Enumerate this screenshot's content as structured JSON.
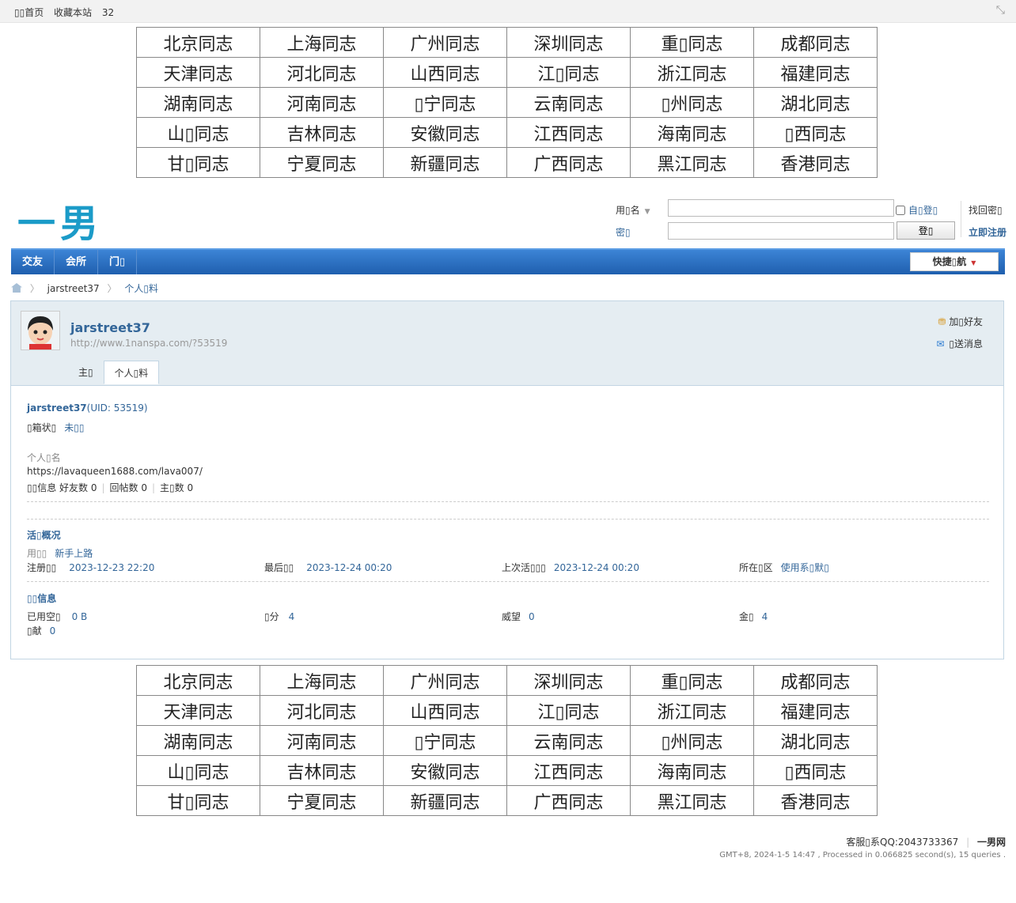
{
  "topbar": {
    "home_label": "▯▯首页",
    "favorite_label": "收藏本站",
    "count": "32"
  },
  "cities": [
    [
      "北京同志",
      "上海同志",
      "广州同志",
      "深圳同志",
      "重▯同志",
      "成都同志"
    ],
    [
      "天津同志",
      "河北同志",
      "山西同志",
      "江▯同志",
      "浙江同志",
      "福建同志"
    ],
    [
      "湖南同志",
      "河南同志",
      "▯宁同志",
      "云南同志",
      "▯州同志",
      "湖北同志"
    ],
    [
      "山▯同志",
      "吉林同志",
      "安徽同志",
      "江西同志",
      "海南同志",
      "▯西同志"
    ],
    [
      "甘▯同志",
      "宁夏同志",
      "新疆同志",
      "广西同志",
      "黑江同志",
      "香港同志"
    ]
  ],
  "logo": "一男",
  "login": {
    "username_label": "用▯名",
    "password_label": "密▯",
    "auto_login": "自▯登▯",
    "login_button": "登▯",
    "forgot": "找回密▯",
    "register": "立即注册"
  },
  "nav": {
    "items": [
      "交友",
      "会所",
      "门▯"
    ],
    "quick": "快捷▯航"
  },
  "breadcrumb": {
    "user": "jarstreet37",
    "page": "个人▯料"
  },
  "profile": {
    "username": "jarstreet37",
    "url": "http://www.1nanspa.com/?53519",
    "add_friend": "加▯好友",
    "send_message": "▯送消息",
    "tabs": [
      "主▯",
      "个人▯料"
    ],
    "uid_line_name": "jarstreet37",
    "uid_line_uid": "(UID: 53519)",
    "email_status_label": "▯箱状▯",
    "email_status_value": "未▯▯",
    "signature_label": "个人▯名",
    "signature": "https://lavaqueen1688.com/lava007/",
    "stats_label": "▯▯信息",
    "friends": "好友数 0",
    "replies": "回帖数 0",
    "threads": "主▯数 0",
    "activity_title": "活▯概况",
    "group_label": "用▯▯",
    "group_value": "新手上路",
    "reg_label": "注册▯▯",
    "reg_value": "2023-12-23 22:20",
    "last_visit_label": "最后▯▯",
    "last_visit_value": "2023-12-24 00:20",
    "last_active_label": "上次活▯▯▯",
    "last_active_value": "2023-12-24 00:20",
    "zone_label": "所在▯区",
    "zone_value": "使用系▯默▯",
    "stats_title": "▯▯信息",
    "space_label": "已用空▯",
    "space_value": "0 B",
    "points_label": "▯分",
    "points_value": "4",
    "prestige_label": "威望",
    "prestige_value": "0",
    "gold_label": "金▯",
    "gold_value": "4",
    "contrib_label": "▯献",
    "contrib_value": "0"
  },
  "footer": {
    "contact": "客服▯系QQ:2043733367",
    "site": "一男网",
    "info": "GMT+8, 2024-1-5 14:47 , Processed in 0.066825 second(s), 15 queries ."
  }
}
